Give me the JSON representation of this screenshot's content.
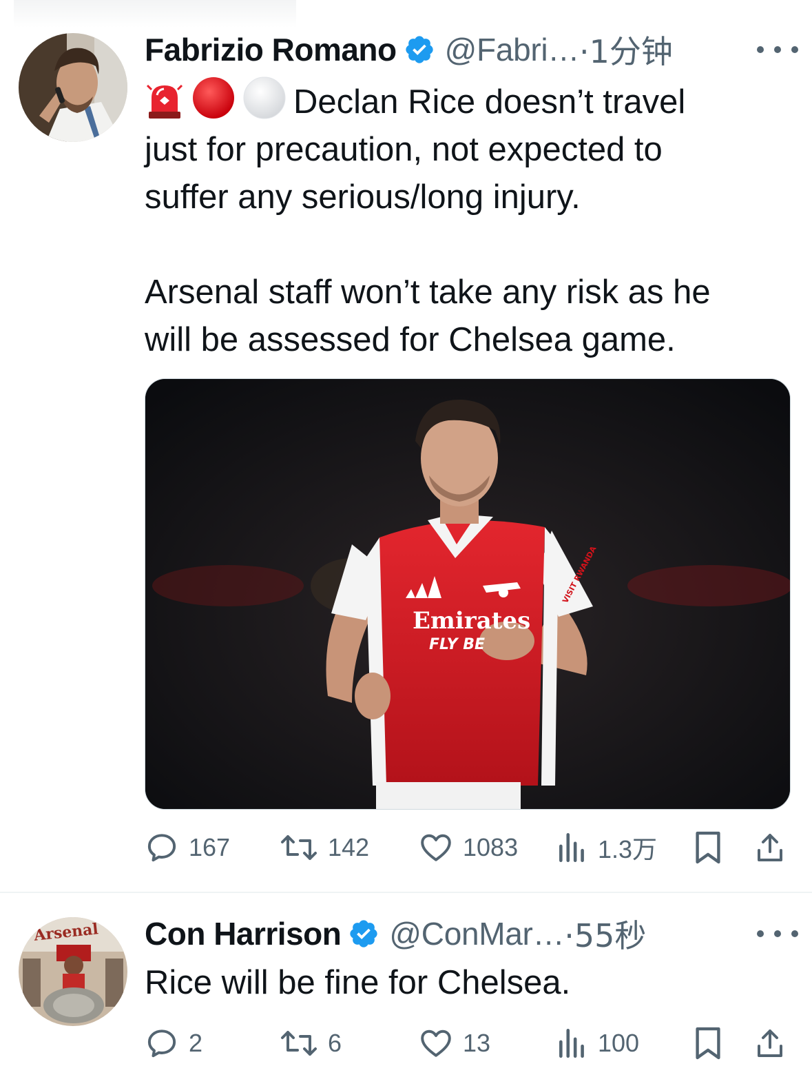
{
  "tweets": [
    {
      "author": {
        "name": "Fabrizio Romano",
        "handle": "@Fabri…",
        "time": "·1分钟",
        "verified": true
      },
      "emojis": [
        "police-light-emoji",
        "red-circle-emoji",
        "white-circle-emoji"
      ],
      "text_lines": [
        "Declan Rice doesn’t travel",
        "just for precaution, not expected to",
        "suffer any serious/long injury."
      ],
      "text_paragraph2": [
        "Arsenal staff won’t take any risk as he",
        "will be assessed for Chelsea game."
      ],
      "media": {
        "jersey_sponsor": "Emirates",
        "jersey_sub": "FLY BE",
        "jersey_sleeve": "VISIT RWANDA"
      },
      "metrics": {
        "replies": "167",
        "retweets": "142",
        "likes": "1083",
        "views": "1.3万"
      }
    },
    {
      "author": {
        "name": "Con Harrison",
        "handle": "@ConMar…",
        "time": "·55秒",
        "verified": true
      },
      "text": "Rice will be fine for Chelsea.",
      "avatar_text": "Arsenal",
      "metrics": {
        "replies": "2",
        "retweets": "6",
        "likes": "13",
        "views": "100"
      }
    }
  ],
  "colors": {
    "text": "#0f1419",
    "secondary": "#536471",
    "verified": "#1d9bf0",
    "arsenal_red": "#db0007"
  }
}
